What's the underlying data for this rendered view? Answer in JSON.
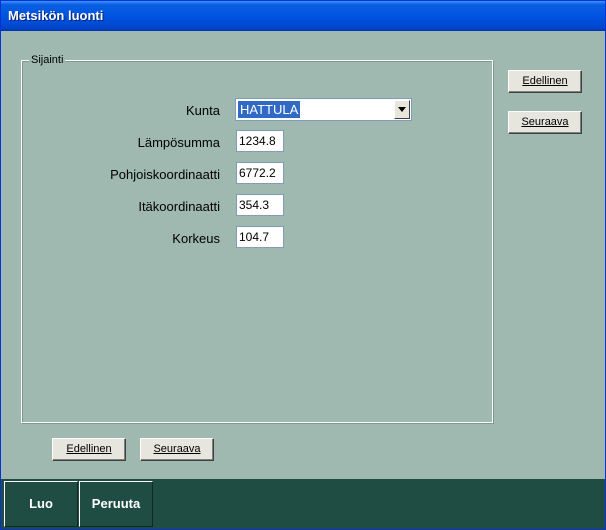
{
  "window": {
    "title": "Metsikön luonti"
  },
  "group": {
    "legend": "Sijainti"
  },
  "form": {
    "kunta_label": "Kunta",
    "kunta_value": "HATTULA",
    "lamposumma_label": "Lämpösumma",
    "lamposumma_value": "1234.8",
    "pohjois_label": "Pohjoiskoordinaatti",
    "pohjois_value": "6772.2",
    "ita_label": "Itäkoordinaatti",
    "ita_value": "354.3",
    "korkeus_label": "Korkeus",
    "korkeus_value": "104.7"
  },
  "side_buttons": {
    "prev": "Edellinen",
    "next": "Seuraava"
  },
  "bottom_buttons": {
    "prev": "Edellinen",
    "next": "Seuraava"
  },
  "footer": {
    "create": "Luo",
    "cancel": "Peruuta"
  },
  "colors": {
    "background": "#9fb9b0",
    "footer": "#1f4d43",
    "titlebar": "#0054e3",
    "selection": "#316ac5"
  }
}
